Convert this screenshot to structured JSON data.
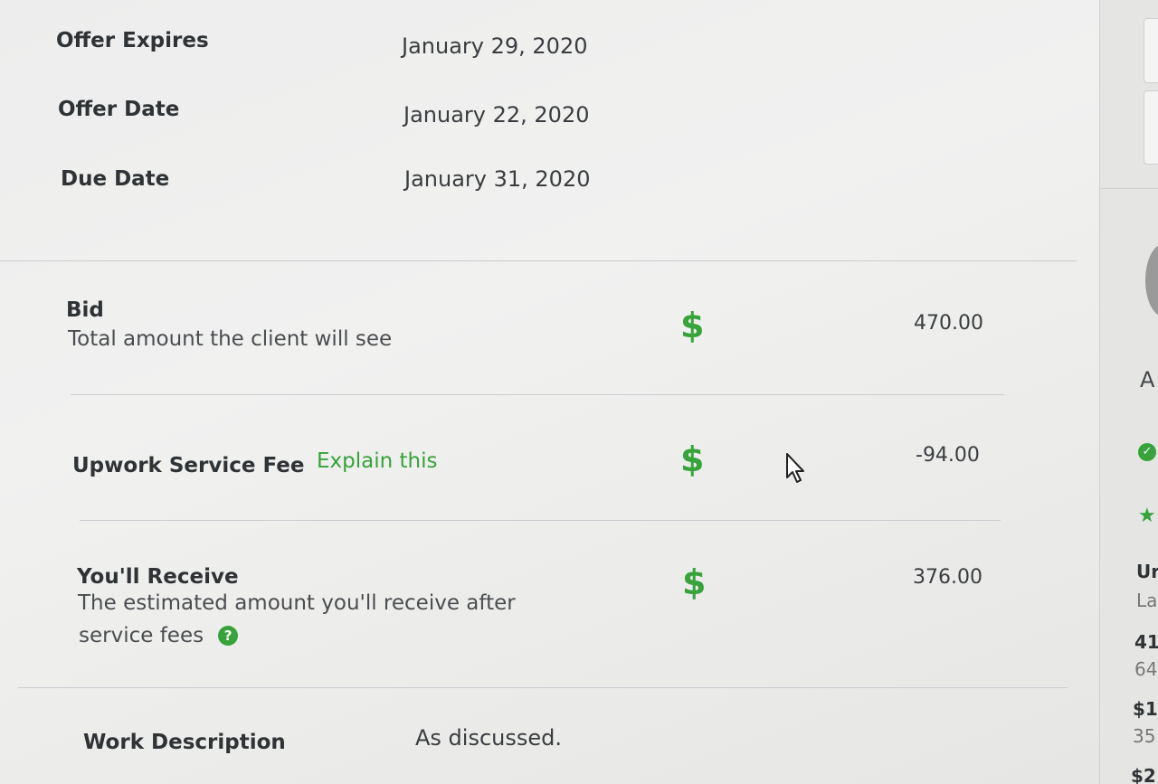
{
  "offer": {
    "expires_label": "Offer Expires",
    "expires_value": "January 29, 2020",
    "date_label": "Offer Date",
    "date_value": "January 22, 2020",
    "due_label": "Due Date",
    "due_value": "January 31, 2020"
  },
  "bid": {
    "label": "Bid",
    "description": "Total amount the client will see",
    "currency": "$",
    "amount": "470.00"
  },
  "fee": {
    "label": "Upwork Service Fee",
    "explain_link": "Explain this",
    "currency": "$",
    "amount": "-94.00"
  },
  "receive": {
    "label": "You'll Receive",
    "description_line1": "The estimated amount you'll receive after",
    "description_line2": "service fees",
    "help_icon": "?",
    "currency": "$",
    "amount": "376.00"
  },
  "work": {
    "label": "Work Description",
    "value": "As discussed."
  },
  "right_panel": {
    "letter": "A",
    "check_icon": "check-circle-icon",
    "star_icon": "star-icon",
    "text_1": "Ur",
    "text_2": "La",
    "text_3": "41",
    "text_4": "64",
    "text_5": "$1(",
    "text_6": "35",
    "text_7": "$2"
  },
  "colors": {
    "accent_green": "#37a33a",
    "text_dark": "#2f3335",
    "divider": "#c9cdd0"
  }
}
